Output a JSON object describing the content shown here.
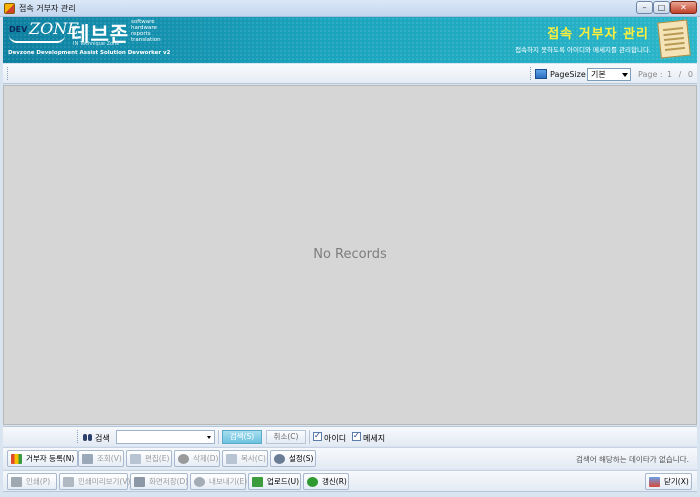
{
  "window": {
    "title": "접속 거부자 관리",
    "controls": {
      "minimize": "–",
      "maximize": "□",
      "close": "✕"
    }
  },
  "banner": {
    "logo_dev": "DEV",
    "logo_zone": "ZONE",
    "logo_korean": "데브존",
    "logo_tagline": "IN Technique Zone",
    "logo_services": [
      "software",
      "hardware",
      "reports",
      "translation"
    ],
    "subtitle": "Devzone Development Assist Solution Devworker v2",
    "title": "접속 거부자 관리",
    "description": "접속하지 못하도록 아이디와 메세지를 관리합니다."
  },
  "toolbar": {
    "pagesize_label": "PageSize",
    "pagesize_value": "기본",
    "page_label": "Page :",
    "page_value": "1 / 0"
  },
  "grid": {
    "empty_text": "No Records"
  },
  "searchbar": {
    "search_label": "검색",
    "search_value": "",
    "search_button": "검색(S)",
    "cancel_button": "취소(C)",
    "checkbox_id": "아이디",
    "checkbox_message": "메세지"
  },
  "actions_row1": {
    "register": "거부자 등록(N)",
    "view": "조회(V)",
    "edit": "편집(E)",
    "delete": "삭제(D)",
    "copy": "복사(C)",
    "settings": "설정(S)",
    "status": "검색어 해당하는 데이타가 없습니다."
  },
  "actions_row2": {
    "print": "인쇄(P)",
    "print_preview": "인쇄미리보기(V)",
    "screen_capture": "화면저장(D)",
    "export": "내보내기(E)",
    "upload": "업로드(U)",
    "refresh": "갱신(R)",
    "close": "닫기(X)"
  }
}
